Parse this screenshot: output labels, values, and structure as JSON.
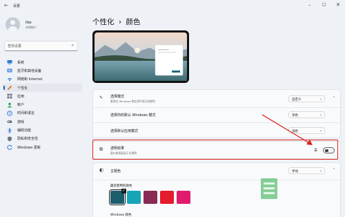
{
  "window": {
    "title": "设置",
    "back_icon": "back-arrow-icon",
    "controls": [
      "minimize-icon",
      "maximize-icon",
      "close-icon"
    ]
  },
  "profile": {
    "name": "like",
    "account_type": "本地帐户"
  },
  "search": {
    "placeholder": "查找设置",
    "icon": "search-icon"
  },
  "nav": {
    "items": [
      {
        "label": "系统",
        "icon": "monitor-icon",
        "color": "#2f7ad3"
      },
      {
        "label": "蓝牙和其他设备",
        "icon": "bluetooth-icon",
        "color": "#2f7ad3"
      },
      {
        "label": "网络和 Internet",
        "icon": "wifi-icon",
        "color": "#2f7ad3"
      },
      {
        "label": "个性化",
        "icon": "pen-icon",
        "color": "#d97d2d",
        "active": true
      },
      {
        "label": "应用",
        "icon": "apps-icon",
        "color": "#6f7786"
      },
      {
        "label": "帐户",
        "icon": "person-icon",
        "color": "#22a25c"
      },
      {
        "label": "时间和语言",
        "icon": "globe-clock-icon",
        "color": "#2f7ad3"
      },
      {
        "label": "游戏",
        "icon": "gamepad-icon",
        "color": "#6f7786"
      },
      {
        "label": "辅助功能",
        "icon": "accessibility-icon",
        "color": "#2f7ad3"
      },
      {
        "label": "隐私和安全性",
        "icon": "shield-icon",
        "color": "#6f7786"
      },
      {
        "label": "Windows 更新",
        "icon": "update-icon",
        "color": "#2f7ad3"
      }
    ]
  },
  "page": {
    "breadcrumb_parent": "个性化",
    "separator": "›",
    "title": "颜色"
  },
  "mode_card": {
    "icon": "brush-icon",
    "title": "选择模式",
    "subtitle": "更改在 Windows 和应用中显示的颜色",
    "value": "自定义",
    "windows_mode": {
      "label": "选择你的默认 Windows 模式",
      "value": "深色"
    },
    "app_mode": {
      "label": "选择默认应用模式",
      "value": "浅色"
    }
  },
  "transparency": {
    "icon": "transparency-icon",
    "title": "透明效果",
    "subtitle": "窗口和表面显示半透明",
    "state_label": "关",
    "on": false
  },
  "accent": {
    "icon": "palette-icon",
    "title": "主题色",
    "value": "手动",
    "recent_label": "最近使用的颜色",
    "recent_colors": [
      "#1a5d6b",
      "#17a5b7",
      "#8a2a55",
      "#e51b2e",
      "#e01b6e"
    ],
    "selected_index": 0,
    "windows_colors_label": "Windows 颜色"
  },
  "colors": {
    "accent": "#0067c0",
    "highlight_box": "#e0201b",
    "arrow": "#e0201b"
  }
}
